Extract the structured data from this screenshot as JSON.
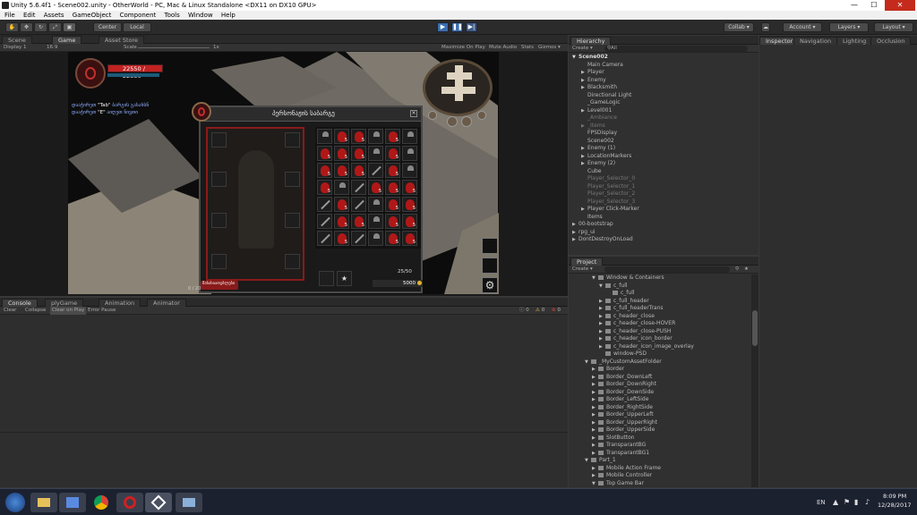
{
  "window": {
    "title": "Unity 5.6.4f1 - Scene002.unity - OtherWorld - PC, Mac & Linux Standalone <DX11 on DX10 GPU>",
    "min": "—",
    "max": "☐",
    "close": "✕"
  },
  "menu": [
    "File",
    "Edit",
    "Assets",
    "GameObject",
    "Component",
    "Tools",
    "Window",
    "Help"
  ],
  "toolbar": {
    "center": "Center",
    "local": "Local",
    "collab": "Collab ▾",
    "account": "Account ▾",
    "layers": "Layers ▾",
    "layout": "Layout ▾"
  },
  "scene_tabs": {
    "scene": "Scene",
    "game": "Game",
    "asset_store": "Asset Store"
  },
  "game_bar": {
    "display": "Display 1",
    "aspect": "16:9",
    "scale_label": "Scale",
    "scale_value": "1x",
    "maximize": "Maximize On Play",
    "mute": "Mute Audio",
    "stats": "Stats",
    "gizmos": "Gizmos ▾"
  },
  "game": {
    "hp": "22550 / 22550",
    "hint1_pre": "დააჭირეთ",
    "hint1_key": "\"Tab\"",
    "hint1_post": "ბარგის გასახსნ",
    "hint2_pre": "დააჭირეთ",
    "hint2_key": "\"E\"",
    "hint2_post": " აიღეთ ნივთი",
    "inventory_title": "პერსონაჟის საბარგე",
    "capacity": "25/50",
    "gold": "5000",
    "char_label": "მახასიათებლები",
    "char_count": "0 / 20",
    "stack": "5",
    "grid": [
      [
        "axe",
        "potion",
        "potion",
        "axe",
        "potion",
        "axe"
      ],
      [
        "potion",
        "potion",
        "potion",
        "axe",
        "potion",
        "axe"
      ],
      [
        "potion",
        "potion",
        "potion",
        "sword",
        "potion",
        "axe"
      ],
      [
        "potion",
        "axe",
        "sword",
        "potion",
        "potion",
        "potion"
      ],
      [
        "sword",
        "potion",
        "sword",
        "axe",
        "potion",
        "potion"
      ],
      [
        "sword",
        "potion",
        "potion",
        "axe",
        "potion",
        "potion"
      ],
      [
        "sword",
        "potion",
        "sword",
        "axe",
        "potion",
        "potion"
      ]
    ]
  },
  "console_tabs": {
    "console": "Console",
    "plygame": "plyGame",
    "animation": "Animation",
    "animator": "Animator"
  },
  "console_bar": {
    "clear": "Clear",
    "collapse": "Collapse",
    "clear_on_play": "Clear on Play",
    "error_pause": "Error Pause",
    "msg_count": "0",
    "warn_count": "0",
    "err_count": "0"
  },
  "hierarchy": {
    "tab": "Hierarchy",
    "create": "Create ▾",
    "search": "⚲All",
    "items": [
      {
        "label": "Scene002",
        "indent": 0,
        "style": "bold",
        "arrow": "▼"
      },
      {
        "label": "Main Camera",
        "indent": 1,
        "style": "",
        "arrow": ""
      },
      {
        "label": "Player",
        "indent": 1,
        "style": "",
        "arrow": "▶"
      },
      {
        "label": "Enemy",
        "indent": 1,
        "style": "",
        "arrow": "▶"
      },
      {
        "label": "Blacksmith",
        "indent": 1,
        "style": "",
        "arrow": "▶"
      },
      {
        "label": "Directional Light",
        "indent": 1,
        "style": "",
        "arrow": ""
      },
      {
        "label": "_GameLogic",
        "indent": 1,
        "style": "",
        "arrow": ""
      },
      {
        "label": "Level001",
        "indent": 1,
        "style": "",
        "arrow": "▶"
      },
      {
        "label": "_Ambiance",
        "indent": 1,
        "style": "dim",
        "arrow": ""
      },
      {
        "label": "_Items",
        "indent": 1,
        "style": "dim",
        "arrow": "▶"
      },
      {
        "label": "FPSDisplay",
        "indent": 1,
        "style": "",
        "arrow": ""
      },
      {
        "label": "Scene002",
        "indent": 1,
        "style": "",
        "arrow": ""
      },
      {
        "label": "Enemy (1)",
        "indent": 1,
        "style": "",
        "arrow": "▶"
      },
      {
        "label": "LocationMarkers",
        "indent": 1,
        "style": "",
        "arrow": "▶"
      },
      {
        "label": "Enemy (2)",
        "indent": 1,
        "style": "",
        "arrow": "▶"
      },
      {
        "label": "Cube",
        "indent": 1,
        "style": "",
        "arrow": ""
      },
      {
        "label": "Player_Selector_0",
        "indent": 1,
        "style": "dim",
        "arrow": ""
      },
      {
        "label": "Player_Selector_1",
        "indent": 1,
        "style": "dim",
        "arrow": ""
      },
      {
        "label": "Player_Selector_2",
        "indent": 1,
        "style": "dim",
        "arrow": ""
      },
      {
        "label": "Player_Selector_3",
        "indent": 1,
        "style": "dim",
        "arrow": ""
      },
      {
        "label": "Player Click-Marker",
        "indent": 1,
        "style": "",
        "arrow": "▶"
      },
      {
        "label": "Items",
        "indent": 1,
        "style": "",
        "arrow": ""
      },
      {
        "label": "00-bootstrap",
        "indent": 0,
        "style": "",
        "arrow": "▶"
      },
      {
        "label": "rpg_ui",
        "indent": 0,
        "style": "",
        "arrow": "▶"
      },
      {
        "label": "DontDestroyOnLoad",
        "indent": 0,
        "style": "",
        "arrow": "▶"
      }
    ]
  },
  "project": {
    "tab": "Project",
    "create": "Create ▾",
    "items": [
      {
        "label": "Window & Containers",
        "indent": 1,
        "arrow": "▼"
      },
      {
        "label": "c_full",
        "indent": 2,
        "arrow": "▼"
      },
      {
        "label": "c_full",
        "indent": 3,
        "arrow": ""
      },
      {
        "label": "c_full_header",
        "indent": 2,
        "arrow": "▶"
      },
      {
        "label": "c_full_headerTrans",
        "indent": 2,
        "arrow": "▶"
      },
      {
        "label": "c_header_close",
        "indent": 2,
        "arrow": "▶"
      },
      {
        "label": "c_header_close-HOVER",
        "indent": 2,
        "arrow": "▶"
      },
      {
        "label": "c_header_close-PUSH",
        "indent": 2,
        "arrow": "▶"
      },
      {
        "label": "c_header_icon_border",
        "indent": 2,
        "arrow": "▶"
      },
      {
        "label": "c_header_icon_image_overlay",
        "indent": 2,
        "arrow": "▶"
      },
      {
        "label": "window-PSD",
        "indent": 2,
        "arrow": ""
      },
      {
        "label": "_MyCustomAssetFolder",
        "indent": 0,
        "arrow": "▼"
      },
      {
        "label": "Border",
        "indent": 1,
        "arrow": "▶"
      },
      {
        "label": "Border_DownLeft",
        "indent": 1,
        "arrow": "▶"
      },
      {
        "label": "Border_DownRight",
        "indent": 1,
        "arrow": "▶"
      },
      {
        "label": "Border_DownSide",
        "indent": 1,
        "arrow": "▶"
      },
      {
        "label": "Border_LeftSide",
        "indent": 1,
        "arrow": "▶"
      },
      {
        "label": "Border_RightSide",
        "indent": 1,
        "arrow": "▶"
      },
      {
        "label": "Border_UpperLeft",
        "indent": 1,
        "arrow": "▶"
      },
      {
        "label": "Border_UpperRight",
        "indent": 1,
        "arrow": "▶"
      },
      {
        "label": "Border_UpperSide",
        "indent": 1,
        "arrow": "▶"
      },
      {
        "label": "SlotButton",
        "indent": 1,
        "arrow": "▶"
      },
      {
        "label": "TransparantBG",
        "indent": 1,
        "arrow": "▶"
      },
      {
        "label": "TransparantBG1",
        "indent": 1,
        "arrow": "▶"
      },
      {
        "label": "Part_1",
        "indent": 0,
        "arrow": "▼"
      },
      {
        "label": "Mobile Action Frame",
        "indent": 1,
        "arrow": "▶"
      },
      {
        "label": "Mobile Controller",
        "indent": 1,
        "arrow": "▶"
      },
      {
        "label": "Top Game Bar",
        "indent": 1,
        "arrow": "▼"
      }
    ]
  },
  "inspector_tabs": {
    "inspector": "Inspector",
    "navigation": "Navigation",
    "lighting": "Lighting",
    "occlusion": "Occlusion"
  },
  "taskbar": {
    "lang": "EN",
    "time": "8:09 PM",
    "date": "12/28/2017"
  }
}
